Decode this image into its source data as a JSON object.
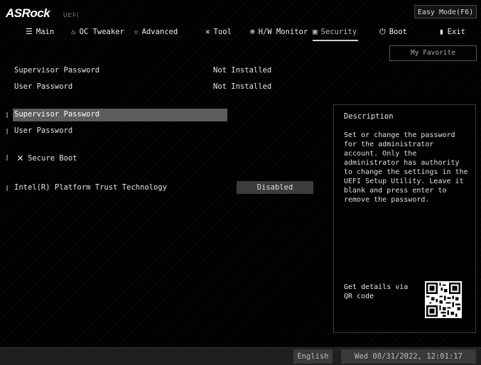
{
  "header": {
    "brand": "ASRock",
    "brand_sub": "UEFI",
    "easy_mode_label": "Easy Mode(F6)"
  },
  "nav": {
    "tabs": [
      {
        "label": "Main",
        "icon": "list-icon",
        "glyph": "☰"
      },
      {
        "label": "OC Tweaker",
        "icon": "flame-icon",
        "glyph": "♨"
      },
      {
        "label": "Advanced",
        "icon": "star-icon",
        "glyph": "☆"
      },
      {
        "label": "Tool",
        "icon": "tools-icon",
        "glyph": "✕"
      },
      {
        "label": "H/W Monitor",
        "icon": "monitor-icon",
        "glyph": "⊕"
      },
      {
        "label": "Security",
        "icon": "shield-icon",
        "glyph": "▣"
      },
      {
        "label": "Boot",
        "icon": "power-icon",
        "glyph": "⏻"
      },
      {
        "label": "Exit",
        "icon": "exit-icon",
        "glyph": "▮"
      }
    ],
    "active_tab": "Security"
  },
  "my_favorite_label": "My Favorite",
  "status_rows": [
    {
      "label": "Supervisor Password",
      "value": "Not Installed"
    },
    {
      "label": "User Password",
      "value": "Not Installed"
    }
  ],
  "menu_items": [
    {
      "label": "Supervisor Password"
    },
    {
      "label": "User Password"
    },
    {
      "label": "Secure Boot"
    },
    {
      "label": "Intel(R) Platform Trust Technology",
      "value": "Disabled"
    }
  ],
  "description": {
    "title": "Description",
    "text": "Set or change the password for the administrator account. Only the administrator has authority to change the settings in the UEFI Setup Utility. Leave it blank and press enter to remove the password.",
    "qr_label": "Get details via QR code"
  },
  "footer": {
    "language": "English",
    "datetime": "Wed 08/31/2022, 12:01:17"
  },
  "colors": {
    "background": "#000000",
    "highlight": "#5c5c5c",
    "text": "#e6e6e6"
  }
}
